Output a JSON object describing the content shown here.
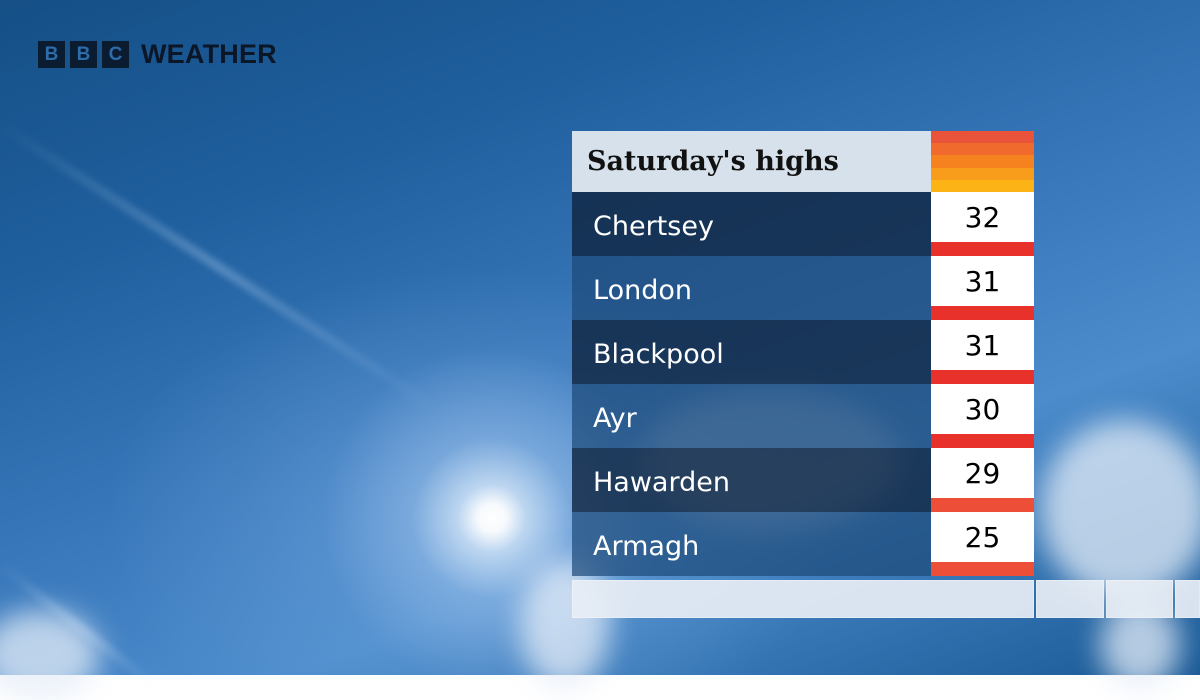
{
  "brand": {
    "letters": [
      "B",
      "B",
      "C"
    ],
    "product": "WEATHER"
  },
  "panel": {
    "title": "Saturday's highs",
    "header_stripe_colors": [
      "#e8533a",
      "#f06a2d",
      "#f5821f",
      "#f89c1c",
      "#fbb316"
    ],
    "rows": [
      {
        "place": "Chertsey",
        "temp": "32",
        "bar_color": "#e8312a"
      },
      {
        "place": "London",
        "temp": "31",
        "bar_color": "#e8312a"
      },
      {
        "place": "Blackpool",
        "temp": "31",
        "bar_color": "#e8312a"
      },
      {
        "place": "Ayr",
        "temp": "30",
        "bar_color": "#e8312a"
      },
      {
        "place": "Hawarden",
        "temp": "29",
        "bar_color": "#ec4e37"
      },
      {
        "place": "Armagh",
        "temp": "25",
        "bar_color": "#ec4e37"
      }
    ]
  }
}
